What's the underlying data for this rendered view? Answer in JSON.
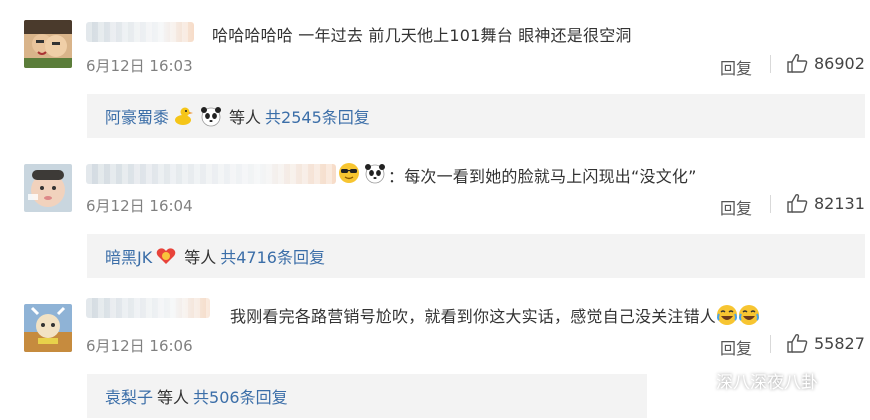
{
  "comments": [
    {
      "text": "哈哈哈哈哈 一年过去 前几天他上101舞台 眼神还是很空洞",
      "time": "6月12日 16:03",
      "reply_label": "回复",
      "likes": "86902",
      "replies": {
        "name": "阿豪蜀黍",
        "mid": "等人",
        "count": "共2545条回复"
      }
    },
    {
      "text": "：每次一看到她的脸就马上闪现出“没文化”",
      "time": "6月12日 16:04",
      "reply_label": "回复",
      "likes": "82131",
      "replies": {
        "name": "暗黑JK",
        "mid": "等人",
        "count": "共4716条回复"
      }
    },
    {
      "text": "我刚看完各路营销号尬吹，就看到你这大实话，感觉自己没关注错人",
      "time": "6月12日 16:06",
      "reply_label": "回复",
      "likes": "55827",
      "replies": {
        "name": "袁梨子",
        "mid": "等人",
        "count": "共506条回复"
      }
    }
  ],
  "watermark": "深八深夜八卦",
  "colors": {
    "link": "#3b6ea8",
    "reply_bg": "#f3f3f3",
    "time": "#808080"
  }
}
